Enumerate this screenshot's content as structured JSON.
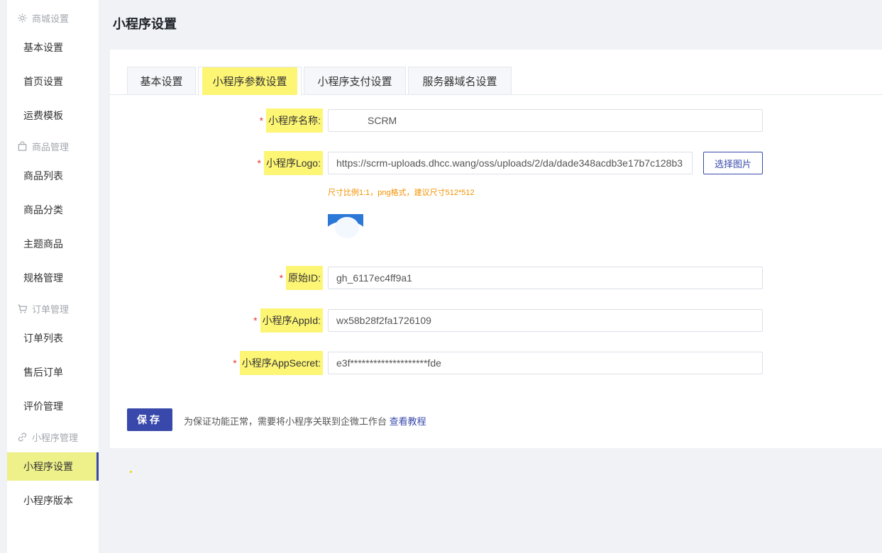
{
  "sidebar": {
    "groups": [
      {
        "title": "商城设置",
        "icon": "gear-icon",
        "items": [
          "基本设置",
          "首页设置",
          "运费模板"
        ]
      },
      {
        "title": "商品管理",
        "icon": "bag-icon",
        "items": [
          "商品列表",
          "商品分类",
          "主题商品",
          "规格管理"
        ]
      },
      {
        "title": "订单管理",
        "icon": "cart-icon",
        "items": [
          "订单列表",
          "售后订单",
          "评价管理"
        ]
      },
      {
        "title": "小程序管理",
        "icon": "link-icon",
        "items": [
          "小程序设置",
          "小程序版本"
        ]
      }
    ],
    "active_item": "小程序设置",
    "active_color": "#eef089",
    "accent_color": "#3949ab"
  },
  "header": {
    "title": "小程序设置"
  },
  "tabs": [
    {
      "label": "基本设置",
      "active": false
    },
    {
      "label": "小程序参数设置",
      "active": true
    },
    {
      "label": "小程序支付设置",
      "active": false
    },
    {
      "label": "服务器域名设置",
      "active": false
    }
  ],
  "form": {
    "required_mark": "*",
    "name": {
      "label": "小程序名称:",
      "value": "SCRM"
    },
    "logo": {
      "label": "小程序Logo:",
      "value": "https://scrm-uploads.dhcc.wang/oss/uploads/2/da/dade348acdb3e17b7c128b3",
      "button": "选择图片",
      "hint": "尺寸比例1:1，png格式，建议尺寸512*512"
    },
    "original_id": {
      "label": "原始ID:",
      "value": "gh_6117ec4ff9a1"
    },
    "appid": {
      "label": "小程序AppId:",
      "value": "wx58b28f2fa1726109"
    },
    "appsecret": {
      "label": "小程序AppSecret:",
      "value": "e3f********************fde"
    }
  },
  "footer": {
    "save_label": "保存",
    "note": "为保证功能正常，需要将小程序关联到企微工作台",
    "link": "查看教程"
  },
  "colors": {
    "primary": "#3949ab",
    "highlight": "#fdf574",
    "hint": "#f29100",
    "required": "#e53935"
  }
}
